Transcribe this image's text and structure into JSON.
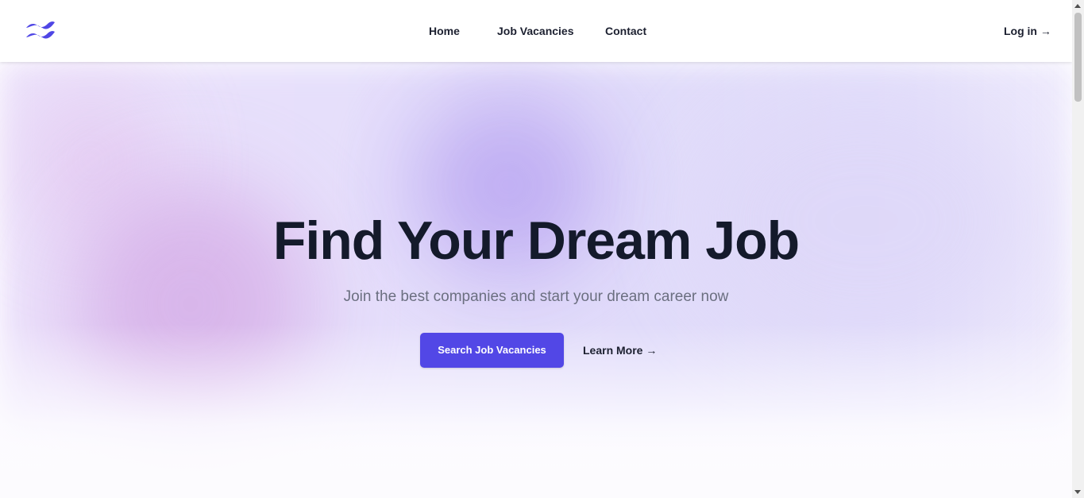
{
  "header": {
    "logo_icon": "tailwind-waves-logo",
    "nav": [
      {
        "label": "Home"
      },
      {
        "label": "Job Vacancies"
      },
      {
        "label": "Contact"
      }
    ],
    "login_label": "Log in →"
  },
  "hero": {
    "title": "Find Your Dream Job",
    "subtitle": "Join the best companies and start your dream career now",
    "primary_button": "Search Job Vacancies",
    "secondary_link": "Learn More →"
  },
  "colors": {
    "accent": "#5247e6",
    "heading": "#141a2b",
    "subtext": "#6b6f80"
  },
  "scrollbar": {
    "up_icon": "triangle-up-icon",
    "down_icon": "triangle-down-icon"
  }
}
